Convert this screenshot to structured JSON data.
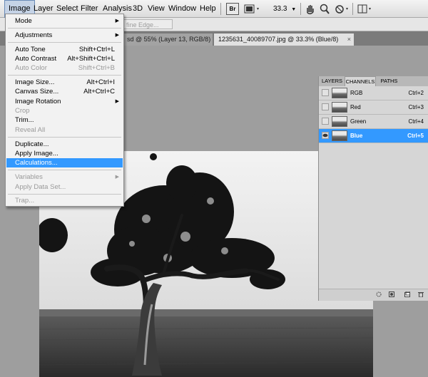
{
  "menubar": {
    "items": [
      "Image",
      "Layer",
      "Select",
      "Filter",
      "Analysis",
      "3D",
      "View",
      "Window",
      "Help"
    ],
    "bridge_label": "Br",
    "zoom": "33.3"
  },
  "options": {
    "refine_edge": "fine Edge..."
  },
  "tabs": [
    {
      "label": "sd @ 55% (Layer 13, RGB/8) *"
    },
    {
      "label": "1235631_40089707.jpg @ 33.3% (Blue/8)"
    }
  ],
  "image_menu": {
    "items": [
      {
        "label": "Mode",
        "shortcut": "",
        "submenu": true,
        "disabled": false
      },
      {
        "label": "Adjustments",
        "shortcut": "",
        "submenu": true,
        "disabled": false
      },
      {
        "label": "Auto Tone",
        "shortcut": "Shift+Ctrl+L",
        "submenu": false,
        "disabled": false
      },
      {
        "label": "Auto Contrast",
        "shortcut": "Alt+Shift+Ctrl+L",
        "submenu": false,
        "disabled": false
      },
      {
        "label": "Auto Color",
        "shortcut": "Shift+Ctrl+B",
        "submenu": false,
        "disabled": true
      },
      {
        "label": "Image Size...",
        "shortcut": "Alt+Ctrl+I",
        "submenu": false,
        "disabled": false
      },
      {
        "label": "Canvas Size...",
        "shortcut": "Alt+Ctrl+C",
        "submenu": false,
        "disabled": false
      },
      {
        "label": "Image Rotation",
        "shortcut": "",
        "submenu": true,
        "disabled": false
      },
      {
        "label": "Crop",
        "shortcut": "",
        "submenu": false,
        "disabled": true
      },
      {
        "label": "Trim...",
        "shortcut": "",
        "submenu": false,
        "disabled": false
      },
      {
        "label": "Reveal All",
        "shortcut": "",
        "submenu": false,
        "disabled": true
      },
      {
        "label": "Duplicate...",
        "shortcut": "",
        "submenu": false,
        "disabled": false
      },
      {
        "label": "Apply Image...",
        "shortcut": "",
        "submenu": false,
        "disabled": false
      },
      {
        "label": "Calculations...",
        "shortcut": "",
        "submenu": false,
        "disabled": false,
        "highlighted": true
      },
      {
        "label": "Variables",
        "shortcut": "",
        "submenu": true,
        "disabled": true
      },
      {
        "label": "Apply Data Set...",
        "shortcut": "",
        "submenu": false,
        "disabled": true
      },
      {
        "label": "Trap...",
        "shortcut": "",
        "submenu": false,
        "disabled": true
      }
    ]
  },
  "panel": {
    "tabs": [
      "LAYERS",
      "CHANNELS",
      "PATHS"
    ],
    "active_tab": "CHANNELS",
    "channels": [
      {
        "name": "RGB",
        "shortcut": "Ctrl+2",
        "selected": false
      },
      {
        "name": "Red",
        "shortcut": "Ctrl+3",
        "selected": false
      },
      {
        "name": "Green",
        "shortcut": "Ctrl+4",
        "selected": false
      },
      {
        "name": "Blue",
        "shortcut": "Ctrl+5",
        "selected": true
      }
    ]
  },
  "colors": {
    "highlight": "#3399ff",
    "menu_bg": "#f2f2f2",
    "canvas_bg": "#9e9e9e"
  }
}
